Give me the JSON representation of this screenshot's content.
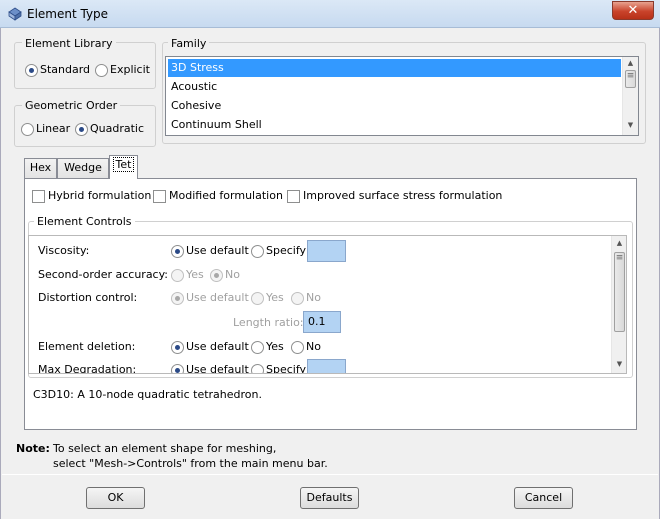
{
  "window": {
    "title": "Element Type",
    "close_symbol": "✕"
  },
  "element_library": {
    "legend": "Element Library",
    "options": [
      {
        "label": "Standard",
        "selected": true
      },
      {
        "label": "Explicit",
        "selected": false
      }
    ]
  },
  "geometric_order": {
    "legend": "Geometric Order",
    "options": [
      {
        "label": "Linear",
        "selected": false
      },
      {
        "label": "Quadratic",
        "selected": true
      }
    ]
  },
  "family": {
    "legend": "Family",
    "items": [
      "3D Stress",
      "Acoustic",
      "Cohesive",
      "Continuum Shell"
    ],
    "selected_index": 0
  },
  "tabs": [
    {
      "label": "Hex"
    },
    {
      "label": "Wedge"
    },
    {
      "label": "Tet",
      "active": true
    }
  ],
  "formulation": {
    "hybrid": "Hybrid formulation",
    "modified": "Modified formulation",
    "improved": "Improved surface stress formulation"
  },
  "element_controls": {
    "legend": "Element Controls",
    "viscosity": {
      "label": "Viscosity:",
      "use_default": "Use default",
      "specify": "Specify",
      "value": ""
    },
    "second_order": {
      "label": "Second-order accuracy:",
      "yes": "Yes",
      "no": "No"
    },
    "distortion": {
      "label": "Distortion control:",
      "use_default": "Use default",
      "yes": "Yes",
      "no": "No",
      "length_ratio_label": "Length ratio:",
      "length_ratio": "0.1"
    },
    "element_deletion": {
      "label": "Element deletion:",
      "use_default": "Use default",
      "yes": "Yes",
      "no": "No"
    },
    "max_degradation": {
      "label": "Max Degradation:",
      "use_default": "Use default",
      "specify": "Specify"
    }
  },
  "element_description": "C3D10:  A 10-node quadratic tetrahedron.",
  "note": {
    "label": "Note:",
    "line1": "To select an element shape for meshing,",
    "line2": "select \"Mesh->Controls\" from the main menu bar."
  },
  "buttons": {
    "ok": "OK",
    "defaults": "Defaults",
    "cancel": "Cancel"
  },
  "icons": {
    "window": "element-type-icon",
    "scroll_up": "▲",
    "scroll_down": "▼"
  }
}
